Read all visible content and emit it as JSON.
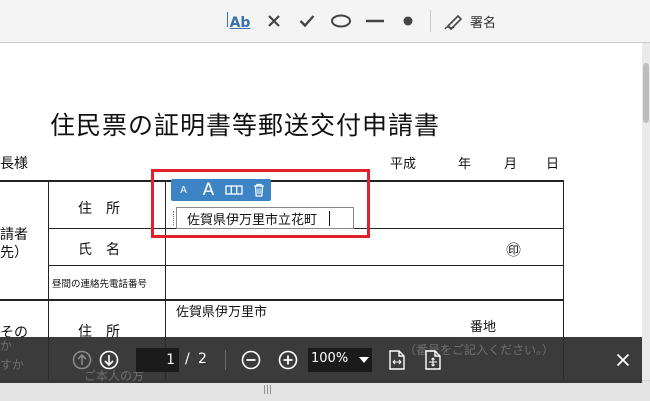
{
  "toolbar": {
    "add_text_icon": "Ab",
    "sign_label": "署名",
    "icons": [
      "add-text-icon",
      "cross-mark-icon",
      "check-mark-icon",
      "ellipse-icon",
      "line-icon",
      "dot-icon",
      "sign-pen-icon"
    ]
  },
  "document": {
    "title": "住民票の証明書等郵送交付申請書",
    "addressee": "長様",
    "date": {
      "era": "平成",
      "year": "年",
      "month": "月",
      "day": "日"
    },
    "applicant_label_1": "請者",
    "applicant_label_2": "先）",
    "row_address_label": "住　所",
    "row_name_label": "氏　名",
    "row_phone_label": "昼間の連絡先電話番号",
    "seal_mark": "㊞",
    "sec2_label_1": "その",
    "sec2_label_2": "か",
    "sec2_label_3": "すか",
    "sec2_address_label": "住　所",
    "sec2_address_prefix": "佐賀県伊万里市",
    "sec2_banchi": "番地",
    "sec2_hint": "（番号をご記入ください。）",
    "sec2_bottom_label": "ご本人の方"
  },
  "form_field": {
    "value": "佐賀県伊万里市立花町",
    "toolbar": {
      "small_font": "A",
      "large_font": "A"
    }
  },
  "navbar": {
    "current_page": "1",
    "separator": "/",
    "total_pages": "2",
    "zoom": "100%"
  },
  "hscroll": {
    "grip": "|||"
  },
  "colors": {
    "highlight": "#e0202a",
    "field_toolbar": "#3d84c6",
    "navbar": "#2c2c2c",
    "icon": "#3a6fb0"
  }
}
